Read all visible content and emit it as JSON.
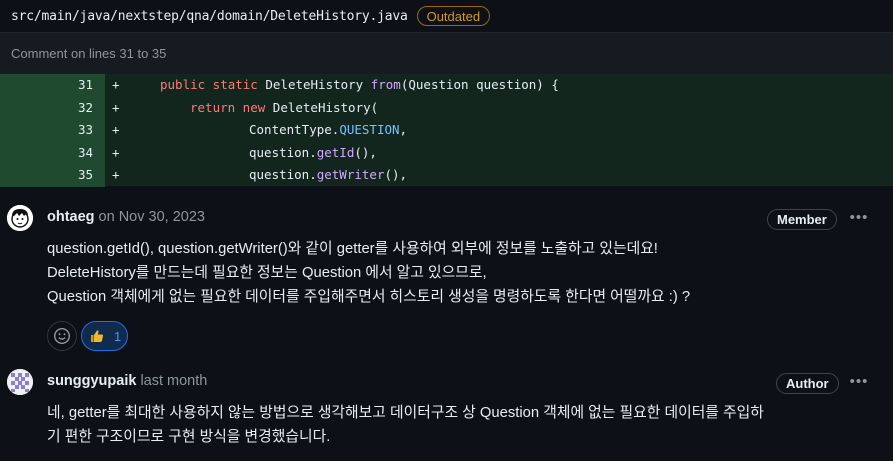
{
  "file": {
    "path": "src/main/java/nextstep/qna/domain/DeleteHistory.java",
    "badge": "Outdated"
  },
  "comment_range": "Comment on lines 31 to 35",
  "code_lines": [
    {
      "num": "31",
      "sign": "+"
    },
    {
      "num": "32",
      "sign": "+"
    },
    {
      "num": "33",
      "sign": "+"
    },
    {
      "num": "34",
      "sign": "+"
    },
    {
      "num": "35",
      "sign": "+"
    }
  ],
  "code_text": {
    "l31_a": "public static",
    "l31_b": " DeleteHistory ",
    "l31_c": "from",
    "l31_d": "(Question question) {",
    "l32_a": "return new",
    "l32_b": " DeleteHistory(",
    "l33_a": "ContentType.",
    "l33_b": "QUESTION",
    "l33_c": ",",
    "l34_a": "question.",
    "l34_b": "getId",
    "l34_c": "(),",
    "l35_a": "question.",
    "l35_b": "getWriter",
    "l35_c": "(),"
  },
  "comments": [
    {
      "author": "ohtaeg",
      "date": "on Nov 30, 2023",
      "role": "Member",
      "lines": [
        "question.getId(), question.getWriter()와 같이 getter를 사용하여 외부에 정보를 노출하고 있는데요!",
        "DeleteHistory를 만드는데 필요한 정보는 Question 에서 알고 있으므로,",
        "Question 객체에게 없는 필요한 데이터를 주입해주면서 히스토리 생성을 명령하도록 한다면 어떨까요 :) ?"
      ],
      "reactions": {
        "thumbs_up_count": "1"
      }
    },
    {
      "author": "sunggyupaik",
      "date": "last month",
      "role": "Author",
      "lines": [
        "네, getter를 최대한 사용하지 않는 방법으로 생각해보고 데이터구조 상 Question 객체에 없는 필요한 데이터를 주입하",
        "기 편한 구조이므로 구현 방식을 변경했습니다."
      ]
    }
  ],
  "colors": {
    "accent": "#4493f8",
    "outdated": "#d29922",
    "added_line_bg": "#12261e",
    "added_num_bg": "#1f4a2f"
  },
  "icons": [
    "smiley-icon",
    "thumbs-up-icon",
    "kebab-icon"
  ]
}
